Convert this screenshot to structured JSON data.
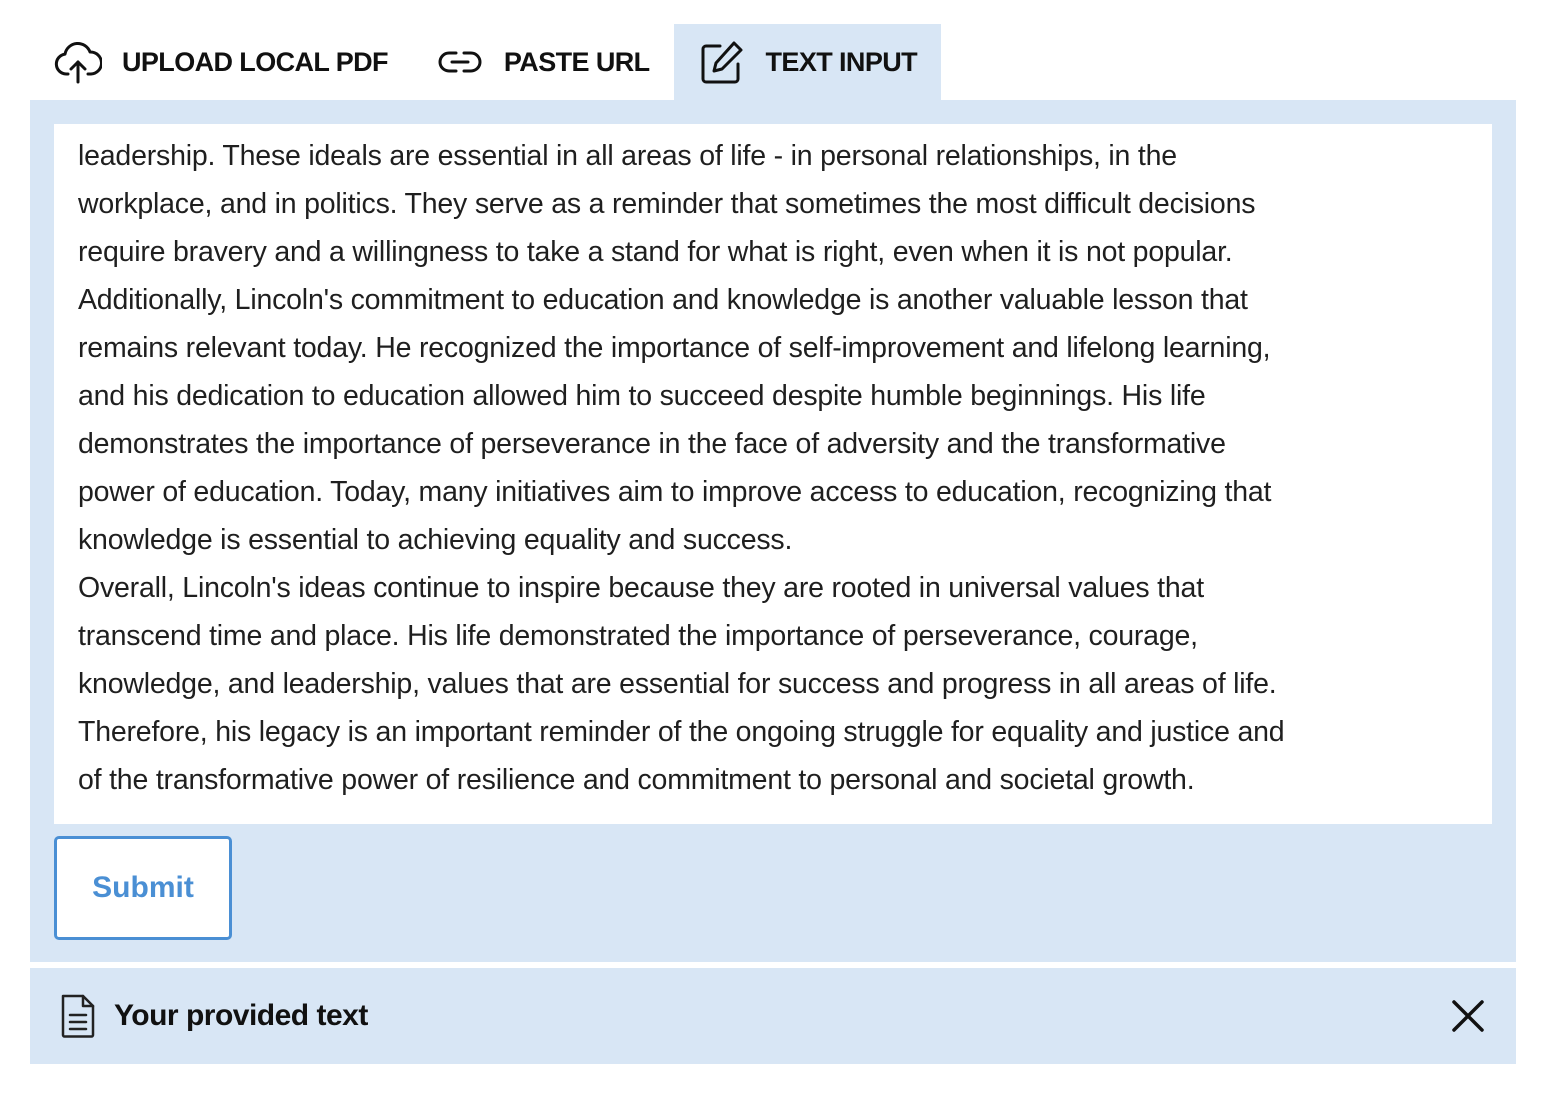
{
  "tabs": [
    {
      "label": "UPLOAD LOCAL PDF",
      "icon": "cloud-upload-icon",
      "active": false
    },
    {
      "label": "PASTE URL",
      "icon": "link-icon",
      "active": false
    },
    {
      "label": "TEXT INPUT",
      "icon": "edit-icon",
      "active": true
    }
  ],
  "text_input": {
    "lines": [
      "leadership. These ideals are essential in all areas of life - in personal relationships, in the",
      "workplace, and in politics. They serve as a reminder that sometimes the most difficult decisions",
      "require bravery and a willingness to take a stand for what is right, even when it is not popular.",
      "Additionally, Lincoln's commitment to education and knowledge is another valuable lesson that",
      "remains relevant today. He recognized the importance of self-improvement and lifelong learning,",
      "and his dedication to education allowed him to succeed despite humble beginnings. His life",
      "demonstrates the importance of perseverance in the face of adversity and the transformative",
      "power of education. Today, many initiatives aim to improve access to education, recognizing that",
      "knowledge is essential to achieving equality and success.",
      "Overall, Lincoln's ideas continue to inspire because they are rooted in universal values that",
      "transcend time and place. His life demonstrated the importance of perseverance, courage,",
      "knowledge, and leadership, values that are essential for success and progress in all areas of life.",
      "Therefore, his legacy is an important reminder of the ongoing struggle for equality and justice and",
      "of the transformative power of resilience and commitment to personal and societal growth."
    ]
  },
  "submit_label": "Submit",
  "result": {
    "title": "Your provided text",
    "icon": "document-icon",
    "close_icon": "close-icon"
  },
  "colors": {
    "panel_bg": "#d8e6f5",
    "accent": "#4a8fd4",
    "text": "#1f1f1f"
  }
}
